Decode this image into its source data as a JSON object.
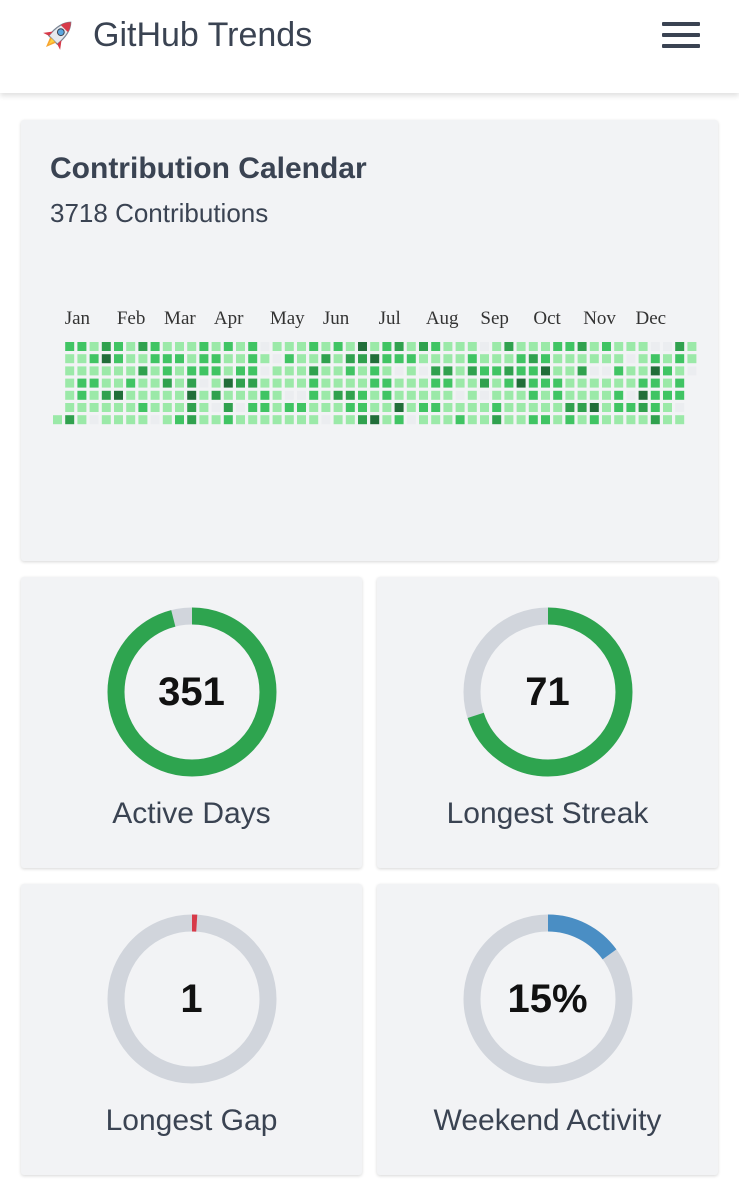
{
  "header": {
    "title": "GitHub Trends",
    "logo_icon": "rocket-icon",
    "menu_icon": "hamburger-menu-icon"
  },
  "calendar": {
    "title": "Contribution Calendar",
    "subtitle": "3718 Contributions",
    "months": [
      "Jan",
      "Feb",
      "Mar",
      "Apr",
      "May",
      "Jun",
      "Jul",
      "Aug",
      "Sep",
      "Oct",
      "Nov",
      "Dec"
    ],
    "weeks": 53,
    "levels": [
      "0000000000000000000000000000000000000000000000000000",
      "",
      "",
      "",
      "",
      "",
      ""
    ],
    "colors": [
      "#ebedf0",
      "#9be9a8",
      "#40c463",
      "#30a14e",
      "#216e39"
    ]
  },
  "stats": [
    {
      "label": "Active Days",
      "value": "351",
      "fraction": 0.96,
      "color": "#2ea44f"
    },
    {
      "label": "Longest Streak",
      "value": "71",
      "fraction": 0.7,
      "color": "#2ea44f"
    },
    {
      "label": "Longest Gap",
      "value": "1",
      "fraction": 0.01,
      "color": "#d73a49"
    },
    {
      "label": "Weekend Activity",
      "value": "15%",
      "fraction": 0.15,
      "color": "#4a8ec4"
    }
  ],
  "ring_track_color": "#d1d5dc"
}
